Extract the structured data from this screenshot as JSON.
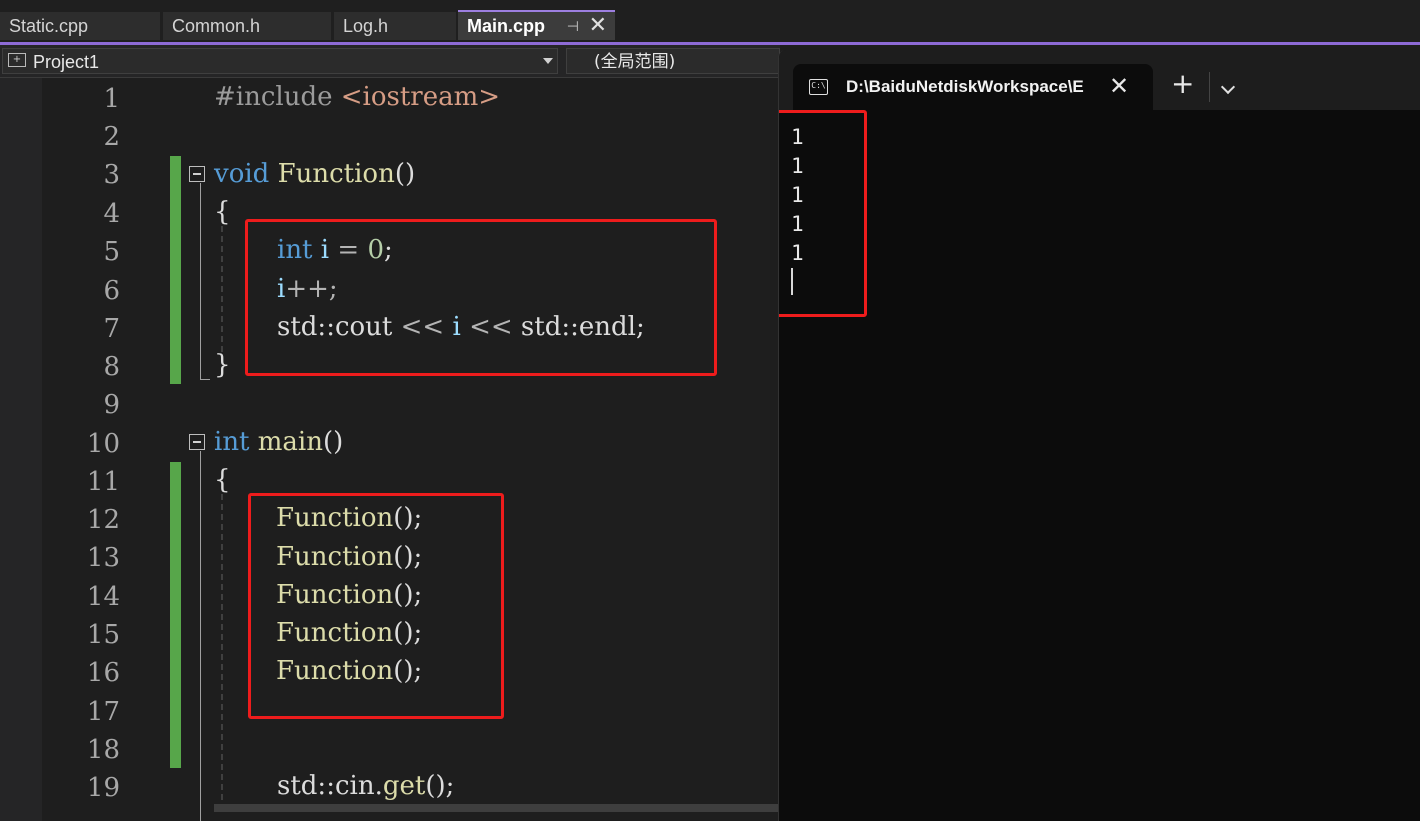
{
  "tabs": [
    {
      "label": "Static.cpp",
      "active": false
    },
    {
      "label": "Common.h",
      "active": false
    },
    {
      "label": "Log.h",
      "active": false
    },
    {
      "label": "Main.cpp",
      "active": true
    }
  ],
  "tab_icons": {
    "pin": "pin-icon",
    "close": "close-icon"
  },
  "navbar": {
    "project": "Project1",
    "scope": "(全局范围)"
  },
  "colors": {
    "accent": "#8e6bd6",
    "change_bar": "#57a64a",
    "highlight_box": "#ee1c1c",
    "keyword": "#569cd6",
    "function": "#dcdcaa"
  },
  "editor": {
    "line_numbers": [
      "1",
      "2",
      "3",
      "4",
      "5",
      "6",
      "7",
      "8",
      "9",
      "10",
      "11",
      "12",
      "13",
      "14",
      "15",
      "16",
      "17",
      "18",
      "19"
    ],
    "code": {
      "l1_directive": "#include",
      "l1_header": "<iostream>",
      "l3_type": "void",
      "l3_name": "Function",
      "l3_parens": "()",
      "l4": "{",
      "l5_type": "int",
      "l5_var": "i",
      "l5_op": "=",
      "l5_num": "0",
      "l5_semi": ";",
      "l6_var": "i",
      "l6_rest": "++;",
      "l7_a": "std::cout",
      "l7_op1": "<<",
      "l7_var": "i",
      "l7_op2": "<<",
      "l7_b": "std::endl;",
      "l8": "}",
      "l10_type": "int",
      "l10_name": "main",
      "l10_parens": "()",
      "l11": "{",
      "call_name": "Function",
      "call_rest": "();",
      "l19_a": "std::cin.",
      "l19_fn": "get",
      "l19_rest": "();"
    }
  },
  "terminal": {
    "title": "D:\\BaiduNetdiskWorkspace\\E",
    "icon": "terminal-icon",
    "output": [
      "1",
      "1",
      "1",
      "1",
      "1"
    ]
  }
}
